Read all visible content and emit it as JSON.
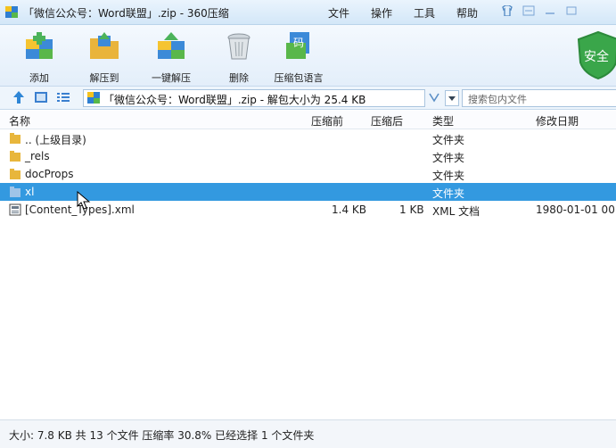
{
  "window": {
    "title": "「微信公众号：Word联盟」.zip - 360压缩",
    "menus": [
      "文件",
      "操作",
      "工具",
      "帮助"
    ]
  },
  "toolbar": {
    "add_label": "添加",
    "extract_to_label": "解压到",
    "one_click_extract_label": "一键解压",
    "delete_label": "删除",
    "zip_lang_label": "压缩包语言",
    "shield_label": "安全"
  },
  "addressbar": {
    "path": "「微信公众号：Word联盟」.zip - 解包大小为 25.4 KB",
    "search_placeholder": "搜索包内文件"
  },
  "columns": {
    "name": "名称",
    "compressed_before": "压缩前",
    "compressed_after": "压缩后",
    "type": "类型",
    "modified": "修改日期"
  },
  "files": [
    {
      "name": ".. (上级目录)",
      "before": "",
      "after": "",
      "type": "文件夹",
      "date": ""
    },
    {
      "name": "_rels",
      "before": "",
      "after": "",
      "type": "文件夹",
      "date": ""
    },
    {
      "name": "docProps",
      "before": "",
      "after": "",
      "type": "文件夹",
      "date": ""
    },
    {
      "name": "xl",
      "before": "",
      "after": "",
      "type": "文件夹",
      "date": ""
    },
    {
      "name": "[Content_Types].xml",
      "before": "1.4 KB",
      "after": "1 KB",
      "type": "XML 文档",
      "date": "1980-01-01 00"
    }
  ],
  "statusbar": {
    "text": "大小: 7.8 KB 共 13 个文件 压缩率 30.8% 已经选择 1 个文件夹"
  },
  "colors": {
    "selection": "#3399e0",
    "accent": "#2e7dc6"
  }
}
